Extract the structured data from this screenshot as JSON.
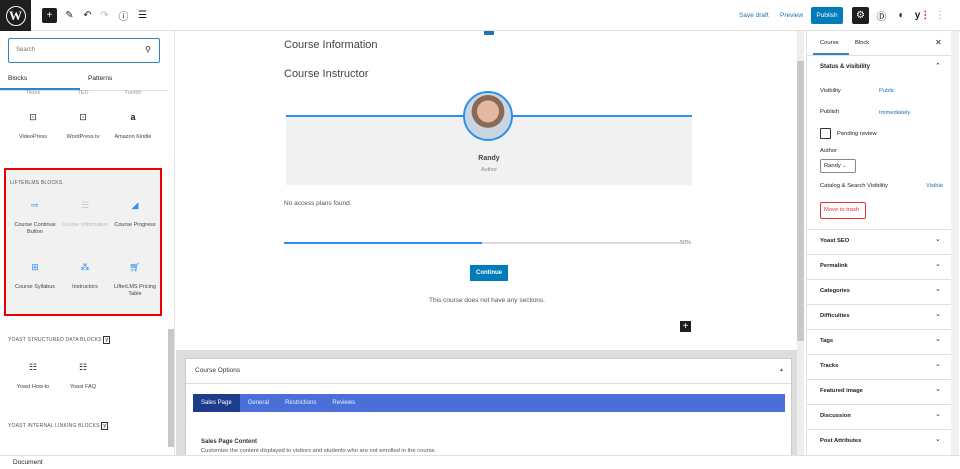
{
  "topbar": {
    "save_draft": "Save draft",
    "preview": "Preview",
    "publish": "Publish",
    "icons": [
      "wordpress-logo",
      "plus",
      "pencil",
      "undo",
      "redo",
      "info",
      "list-view",
      "gear",
      "divi",
      "plugin",
      "yoast",
      "more-vertical"
    ]
  },
  "inserter": {
    "search_placeholder": "Search",
    "tabs": [
      "Blocks",
      "Patterns"
    ],
    "partial_row": [
      "Tiktok",
      "TED",
      "Tumblr"
    ],
    "embed_row": [
      {
        "label": "VideoPress",
        "icon": "video"
      },
      {
        "label": "WordPress.tv",
        "icon": "video"
      },
      {
        "label": "Amazon Kindle",
        "icon": "amazon"
      }
    ],
    "lifterlms": {
      "title": "LIFTERLMS BLOCKS",
      "items": [
        {
          "label": "Course Continue Button",
          "icon": "arrow-right-box"
        },
        {
          "label": "Course Information",
          "icon": "list"
        },
        {
          "label": "Course Progress",
          "icon": "chart"
        },
        {
          "label": "Course Syllabus",
          "icon": "grid"
        },
        {
          "label": "Instructors",
          "icon": "users"
        },
        {
          "label": "LifterLMS Pricing Table",
          "icon": "cart"
        }
      ]
    },
    "yoast_structured": {
      "title": "YOAST STRUCTURED DATA BLOCKS",
      "items": [
        "Yoast How-to",
        "Yoast FAQ"
      ]
    },
    "yoast_linking": {
      "title": "YOAST INTERNAL LINKING BLOCKS"
    }
  },
  "editor": {
    "course_information": "Course Information",
    "course_instructor": "Course Instructor",
    "instructor_name": "Randy",
    "instructor_role": "Author",
    "access_plans": "No access plans found.",
    "progress_percent": 50,
    "progress_label": "50%",
    "continue": "Continue",
    "no_sections": "This course does not have any sections."
  },
  "course_options": {
    "title": "Course Options",
    "tabs": [
      "Sales Page",
      "General",
      "Restrictions",
      "Reviews"
    ],
    "active_tab": "Sales Page",
    "section_title": "Sales Page Content",
    "section_desc": "Customize the content displayed to visitors and students who are not enrolled in the course."
  },
  "sidebar": {
    "tabs": [
      "Course",
      "Block"
    ],
    "status_title": "Status & visibility",
    "visibility_label": "Visibility",
    "visibility_value": "Public",
    "publish_label": "Publish",
    "publish_value": "Immediately",
    "pending": "Pending review",
    "author_label": "Author",
    "author_value": "Randy",
    "catalog_label": "Catalog & Search Visibility",
    "catalog_value": "Visible",
    "trash": "Move to trash",
    "panels": [
      "Yoast SEO",
      "Permalink",
      "Categories",
      "Difficulties",
      "Tags",
      "Tracks",
      "Featured image",
      "Discussion",
      "Post Attributes"
    ]
  },
  "statusbar": {
    "label": "Document"
  },
  "colors": {
    "accent": "#007cba",
    "tabbar": "#4a6fd9",
    "active_tab": "#1e3c8c",
    "highlight": "#ee0000"
  }
}
